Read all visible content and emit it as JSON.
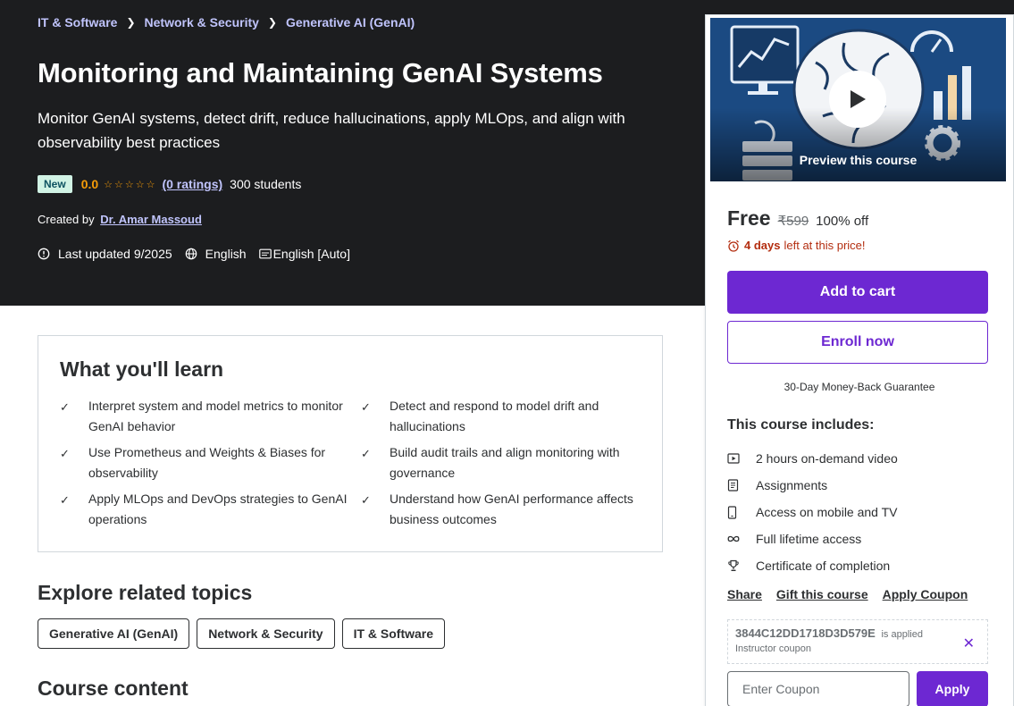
{
  "breadcrumb": [
    "IT & Software",
    "Network & Security",
    "Generative AI (GenAI)"
  ],
  "course": {
    "title": "Monitoring and Maintaining GenAI Systems",
    "subtitle": "Monitor GenAI systems, detect drift, reduce hallucinations, apply MLOps, and align with observability best practices",
    "badge": "New",
    "rating": "0.0",
    "rating_fraction": 0,
    "ratings_count": "(0 ratings)",
    "students": "300 students",
    "created_by_label": "Created by",
    "instructor": "Dr. Amar Massoud",
    "last_updated": "Last updated 9/2025",
    "language": "English",
    "captions": "English [Auto]"
  },
  "learn": {
    "title": "What you'll learn",
    "items": [
      "Interpret system and model metrics to monitor GenAI behavior",
      "Detect and respond to model drift and hallucinations",
      "Use Prometheus and Weights & Biases for observability",
      "Build audit trails and align monitoring with governance",
      "Apply MLOps and DevOps strategies to GenAI operations",
      "Understand how GenAI performance affects business outcomes"
    ]
  },
  "explore": {
    "title": "Explore related topics",
    "topics": [
      "Generative AI (GenAI)",
      "Network & Security",
      "IT & Software"
    ]
  },
  "course_content_title": "Course content",
  "sidebar": {
    "preview_label": "Preview this course",
    "price": "Free",
    "original_price": "₹599",
    "discount": "100% off",
    "timer_bold": "4 days",
    "timer_rest": "left at this price!",
    "add_to_cart": "Add to cart",
    "enroll_now": "Enroll now",
    "guarantee": "30-Day Money-Back Guarantee",
    "includes_title": "This course includes:",
    "includes": [
      {
        "icon": "video-icon",
        "label": "2 hours on-demand video"
      },
      {
        "icon": "assignment-icon",
        "label": "Assignments"
      },
      {
        "icon": "mobile-icon",
        "label": "Access on mobile and TV"
      },
      {
        "icon": "infinity-icon",
        "label": "Full lifetime access"
      },
      {
        "icon": "trophy-icon",
        "label": "Certificate of completion"
      }
    ],
    "links": [
      "Share",
      "Gift this course",
      "Apply Coupon"
    ],
    "coupon_code": "3844C12DD1718D3D579E",
    "coupon_applied": "is applied",
    "coupon_type": "Instructor coupon",
    "coupon_placeholder": "Enter Coupon",
    "apply_label": "Apply"
  },
  "colors": {
    "hero_bg": "#1c1d1f",
    "accent": "#6d28d2",
    "link": "#c0c4fc",
    "star": "#f69c08",
    "timer": "#b32d0f"
  }
}
